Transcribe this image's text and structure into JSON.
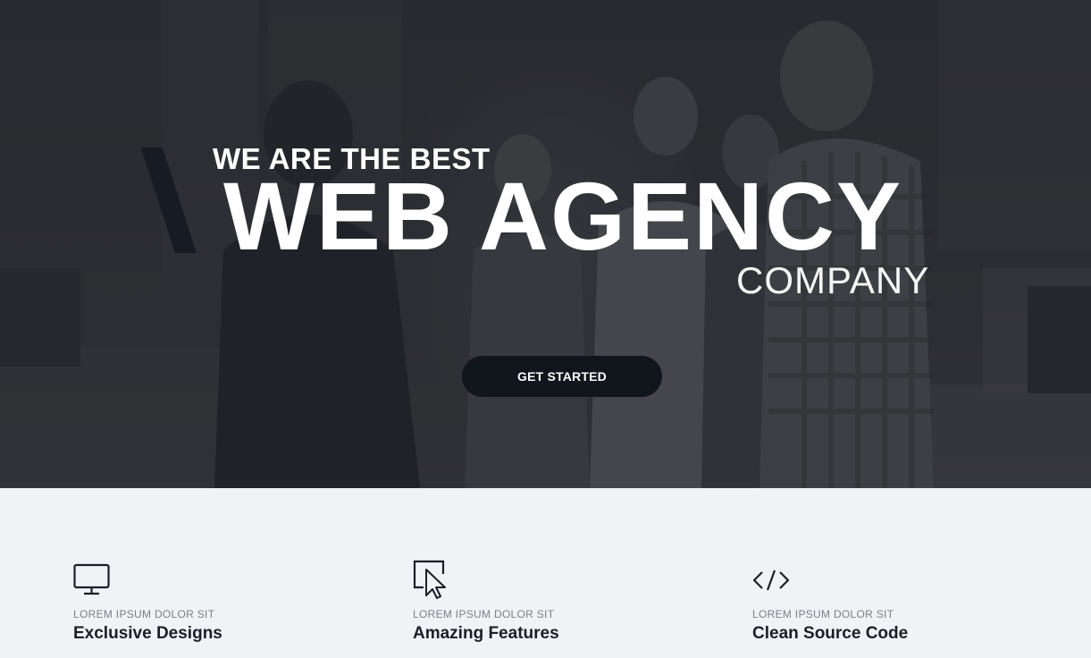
{
  "hero": {
    "kicker": "WE ARE THE BEST",
    "title": "WEB AGENCY",
    "subtitle": "COMPANY",
    "cta_label": "GET STARTED"
  },
  "features": [
    {
      "icon": "monitor-icon",
      "eyebrow": "LOREM IPSUM DOLOR SIT",
      "title": "Exclusive Designs"
    },
    {
      "icon": "cursor-icon",
      "eyebrow": "LOREM IPSUM DOLOR SIT",
      "title": "Amazing Features"
    },
    {
      "icon": "code-icon",
      "eyebrow": "LOREM IPSUM DOLOR SIT",
      "title": "Clean Source Code"
    }
  ],
  "colors": {
    "hero_overlay": "#2f3136",
    "button_bg": "#11151c",
    "features_bg": "#f1f2f6",
    "heading_text": "#1c1f26",
    "eyebrow_text": "#7c7f86"
  }
}
